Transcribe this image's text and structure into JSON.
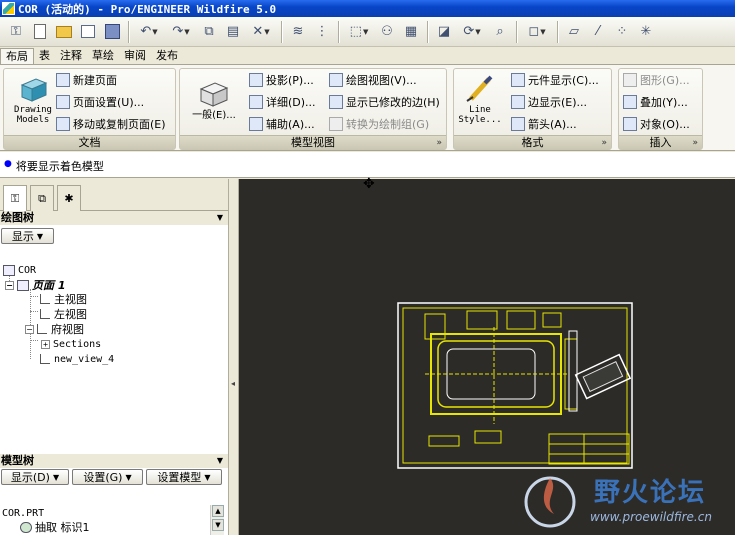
{
  "window": {
    "title": "COR (活动的) - Pro/ENGINEER Wildfire 5.0"
  },
  "menu_tabs": [
    "布局",
    "表",
    "注释",
    "草绘",
    "审阅",
    "发布"
  ],
  "ribbon": {
    "doc_group": {
      "title": "文档",
      "big_button": "Drawing Models",
      "items": [
        "新建页面",
        "页面设置(U)...",
        "移动或复制页面(E)"
      ]
    },
    "model_view_group": {
      "title": "模型视图",
      "big_button": "一般(E)...",
      "items": [
        "投影(P)...",
        "详细(D)...",
        "辅助(A)...",
        "绘图视图(V)...",
        "显示已修改的边(H)",
        "转换为绘制组(G)"
      ]
    },
    "format_group": {
      "title": "格式",
      "big_button": "Line Style...",
      "items": [
        "元件显示(C)...",
        "边显示(E)...",
        "箭头(A)..."
      ]
    },
    "insert_group": {
      "title": "插入",
      "items": [
        "图形(G)...",
        "叠加(Y)...",
        "对象(O)..."
      ]
    }
  },
  "status_message": "将要显示着色模型",
  "drawing_tree": {
    "header": "绘图树",
    "show_button": "显示",
    "root": "COR",
    "page": "页面 1",
    "views": [
      "主视图",
      "左视图",
      "府视图",
      "Sections",
      "new_view_4"
    ]
  },
  "model_tree": {
    "header": "模型树",
    "buttons": [
      "显示(D)",
      "设置(G)",
      "设置模型"
    ],
    "root": "COR.PRT",
    "child": "抽取 标识1"
  },
  "watermark": {
    "title": "野火论坛",
    "url": "www.proewildfire.cn"
  },
  "colors": {
    "graphics_bg": "#2d2b28",
    "drawing_line": "#e6e600",
    "sheet_border": "#ffffff"
  }
}
